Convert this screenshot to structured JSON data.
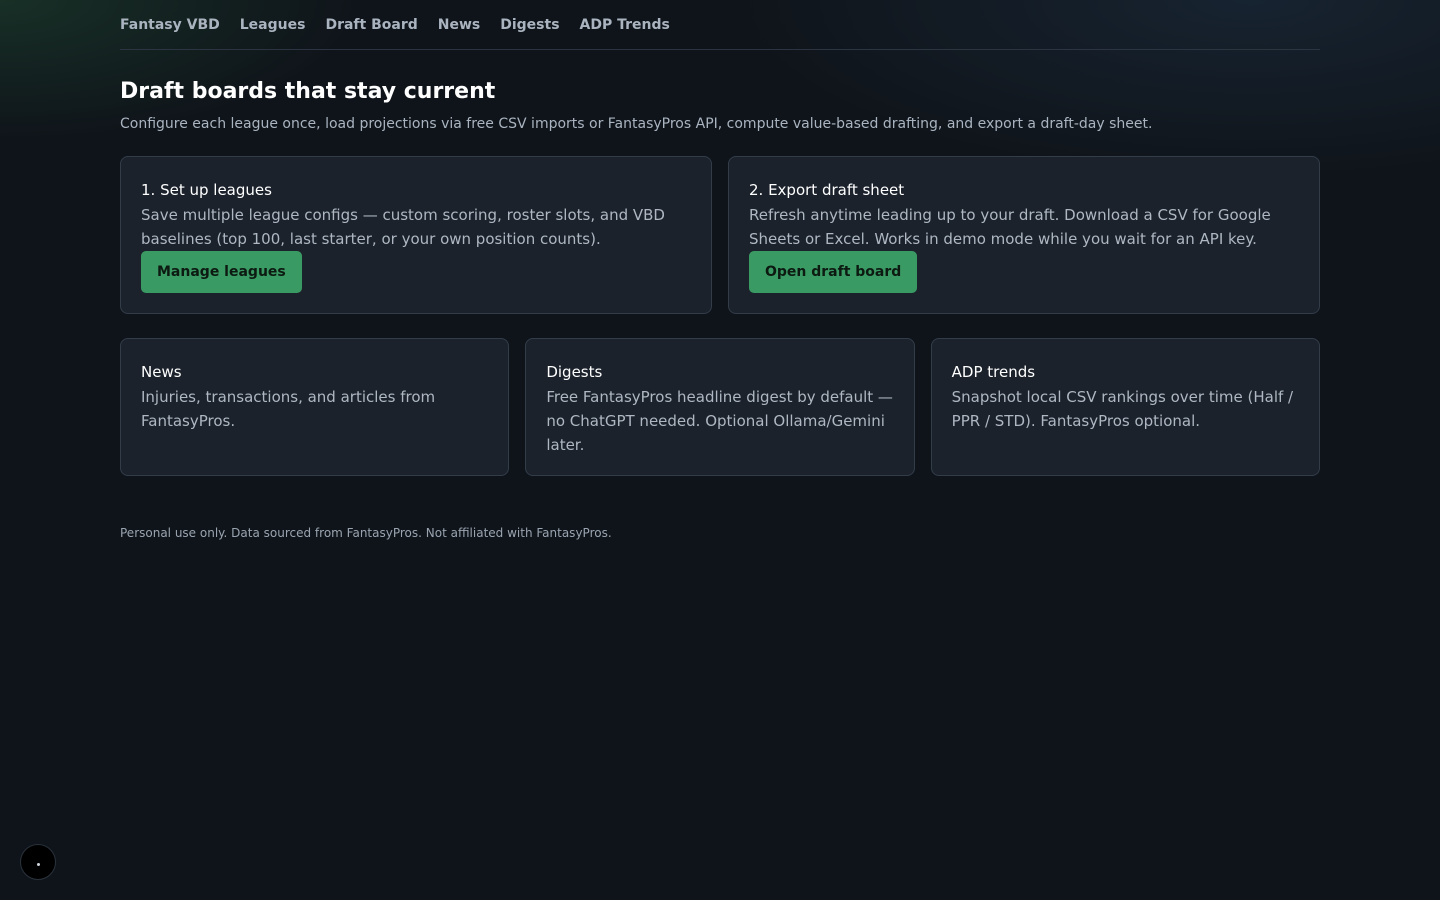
{
  "nav": {
    "items": [
      {
        "label": "Fantasy VBD"
      },
      {
        "label": "Leagues"
      },
      {
        "label": "Draft Board"
      },
      {
        "label": "News"
      },
      {
        "label": "Digests"
      },
      {
        "label": "ADP Trends"
      }
    ]
  },
  "hero": {
    "title": "Draft boards that stay current",
    "subtitle": "Configure each league once, load projections via free CSV imports or FantasyPros API, compute value-based drafting, and export a draft-day sheet."
  },
  "steps": [
    {
      "title": "1. Set up leagues",
      "description": "Save multiple league configs — custom scoring, roster slots, and VBD baselines (top 100, last starter, or your own position counts).",
      "button_label": "Manage leagues"
    },
    {
      "title": "2. Export draft sheet",
      "description": "Refresh anytime leading up to your draft. Download a CSV for Google Sheets or Excel. Works in demo mode while you wait for an API key.",
      "button_label": "Open draft board"
    }
  ],
  "features": [
    {
      "title": "News",
      "description": "Injuries, transactions, and articles from FantasyPros."
    },
    {
      "title": "Digests",
      "description": "Free FantasyPros headline digest by default — no ChatGPT needed. Optional Ollama/Gemini later."
    },
    {
      "title": "ADP trends",
      "description": "Snapshot local CSV rankings over time (Half / PPR / STD). FantasyPros optional."
    }
  ],
  "footer": {
    "text": "Personal use only. Data sourced from FantasyPros. Not affiliated with FantasyPros."
  },
  "colors": {
    "background": "#0f141a",
    "card": "#1b222c",
    "accent_green": "#3a9a63",
    "nav_text": "#aab4c0"
  },
  "icons": {
    "corner_button": "dot-icon"
  }
}
